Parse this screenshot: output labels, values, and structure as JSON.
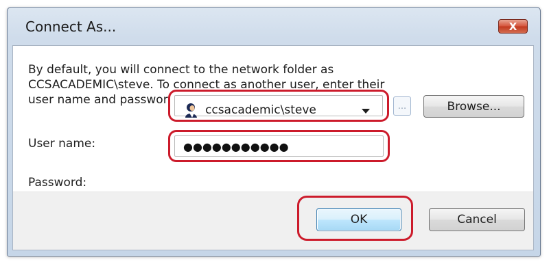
{
  "window": {
    "title": "Connect As...",
    "close_label": "X"
  },
  "description": "By default, you will connect to the network folder as CCSACADEMIC\\steve. To connect as another user, enter their user name and password below.",
  "user_name": {
    "label": "User name:",
    "value": "ccsacademic\\steve",
    "icon": "user-icon"
  },
  "ellipsis_label": "...",
  "browse_label": "Browse...",
  "password": {
    "label": "Password:",
    "value": "●●●●●●●●●●●"
  },
  "buttons": {
    "ok": "OK",
    "cancel": "Cancel"
  },
  "colors": {
    "highlight": "#cc1b2b",
    "close_button": "#d6573f",
    "default_button": "#bee6fd"
  }
}
